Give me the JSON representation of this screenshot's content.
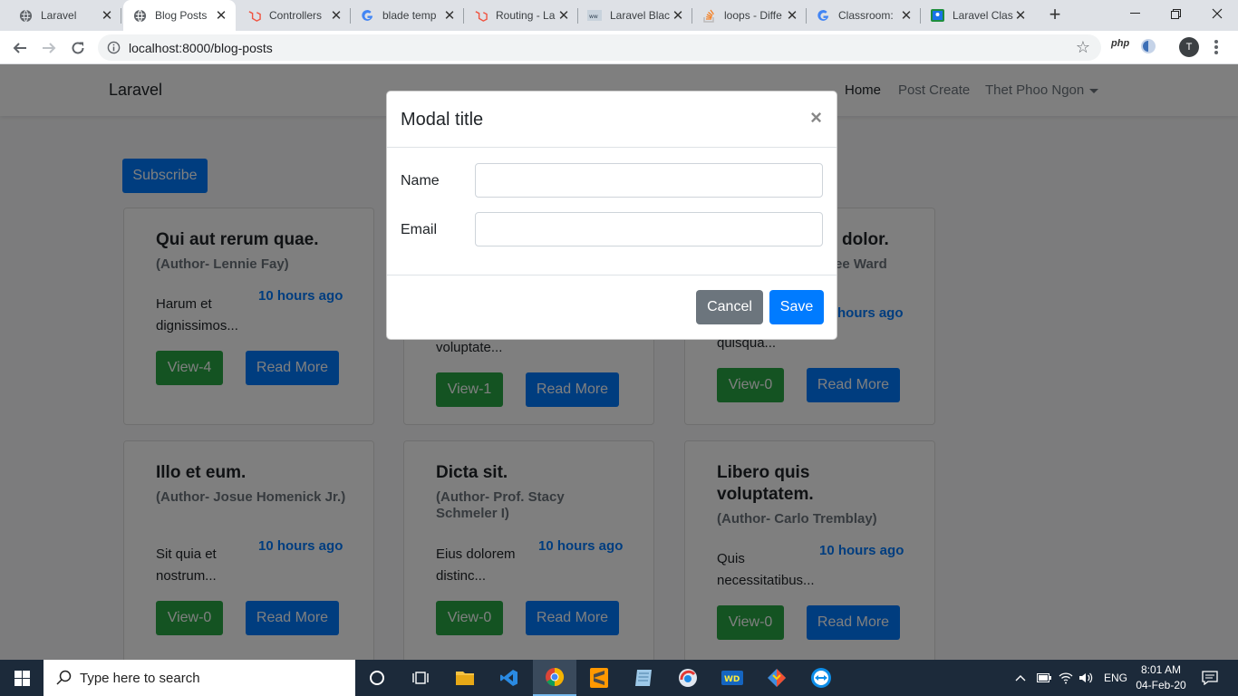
{
  "browser": {
    "tabs": [
      {
        "title": "Laravel",
        "favicon": "globe-icon",
        "active": false
      },
      {
        "title": "Blog Posts",
        "favicon": "globe-icon",
        "active": true
      },
      {
        "title": "Controllers",
        "favicon": "laravel-icon",
        "active": false
      },
      {
        "title": "blade temp",
        "favicon": "google-icon",
        "active": false
      },
      {
        "title": "Routing - La",
        "favicon": "laravel-icon",
        "active": false
      },
      {
        "title": "Laravel Blac",
        "favicon": "site-icon",
        "active": false
      },
      {
        "title": "loops - Diffe",
        "favicon": "stackoverflow-icon",
        "active": false
      },
      {
        "title": "Classroom:",
        "favicon": "google-icon",
        "active": false
      },
      {
        "title": "Laravel Clas",
        "favicon": "classroom-icon",
        "active": false
      }
    ],
    "new_tab": "+",
    "url": "localhost:8000/blog-posts",
    "ext_php": "php",
    "profile_initial": "T"
  },
  "app": {
    "brand": "Laravel",
    "nav": {
      "home": "Home",
      "post_create": "Post Create",
      "user": "Thet Phoo Ngon"
    },
    "subscribe": "Subscribe"
  },
  "posts": [
    {
      "title": "Qui aut rerum quae.",
      "author": "(Author- Lennie Fay)",
      "excerpt": "Harum et dignissimos...",
      "time": "10 hours ago",
      "view": "View-4",
      "read": "Read More"
    },
    {
      "title": "",
      "author": "",
      "excerpt": "voluptate...",
      "time": "",
      "view": "View-1",
      "read": "Read More"
    },
    {
      "title": "dolor.",
      "author": "ee Ward",
      "excerpt": "quisqua...",
      "time": "hours ago",
      "view": "View-0",
      "read": "Read More"
    },
    {
      "title": "Illo et eum.",
      "author": "(Author- Josue Homenick Jr.)",
      "excerpt": "Sit quia et nostrum...",
      "time": "10 hours ago",
      "view": "View-0",
      "read": "Read More"
    },
    {
      "title": "Dicta sit.",
      "author": "(Author- Prof. Stacy Schmeler I)",
      "excerpt": "Eius dolorem distinc...",
      "time": "10 hours ago",
      "view": "View-0",
      "read": "Read More"
    },
    {
      "title": "Libero quis voluptatem.",
      "author": "(Author- Carlo Tremblay)",
      "excerpt": "Quis necessitatibus...",
      "time": "10 hours ago",
      "view": "View-0",
      "read": "Read More"
    }
  ],
  "modal": {
    "title": "Modal title",
    "close": "×",
    "name_label": "Name",
    "name_value": "",
    "email_label": "Email",
    "email_value": "",
    "cancel": "Cancel",
    "save": "Save"
  },
  "taskbar": {
    "search_placeholder": "Type here to search",
    "language": "ENG",
    "time": "8:01 AM",
    "date": "04-Feb-20"
  },
  "colors": {
    "primary": "#007bff",
    "success": "#28a745",
    "secondary": "#6c757d",
    "taskbar": "#1c2a3a"
  }
}
